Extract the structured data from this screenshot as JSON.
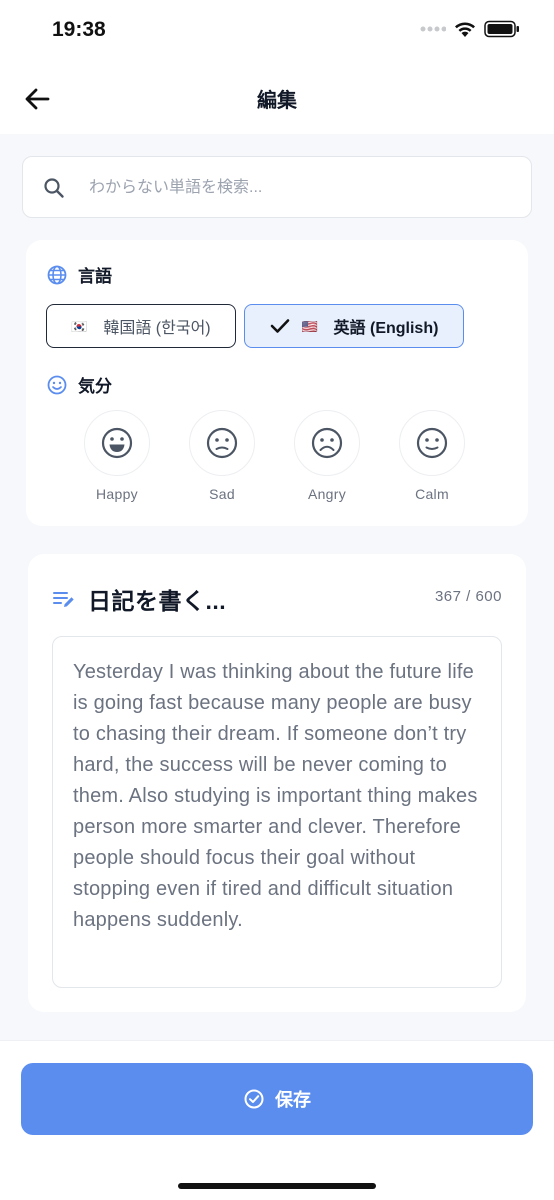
{
  "status_bar": {
    "time": "19:38"
  },
  "nav": {
    "title": "編集",
    "back_icon": "arrow-left-icon"
  },
  "search": {
    "placeholder": "わからない単語を検索..."
  },
  "language": {
    "title": "言語",
    "options": [
      {
        "flag": "🇰🇷",
        "label": "韓国語 (한국어)",
        "selected": false
      },
      {
        "flag": "🇺🇸",
        "label": "英語 (English)",
        "selected": true
      }
    ]
  },
  "mood": {
    "title": "気分",
    "options": [
      {
        "label": "Happy",
        "icon": "happy-face-icon"
      },
      {
        "label": "Sad",
        "icon": "neutral-face-icon"
      },
      {
        "label": "Angry",
        "icon": "sad-face-icon"
      },
      {
        "label": "Calm",
        "icon": "calm-face-icon"
      }
    ]
  },
  "diary": {
    "title": "日記を書く...",
    "char_count": "367 / 600",
    "text": "Yesterday I was thinking about the future life is going fast because many people are busy to chasing their dream. If someone don’t try hard, the success will be never coming to them. Also studying is important thing makes person more smarter and clever. Therefore people should focus their goal without stopping even if tired and difficult situation happens suddenly."
  },
  "save_button": {
    "label": "保存"
  },
  "colors": {
    "accent": "#5b8def",
    "selected_bg": "#e8f0fd",
    "background": "#f6f8fb"
  }
}
